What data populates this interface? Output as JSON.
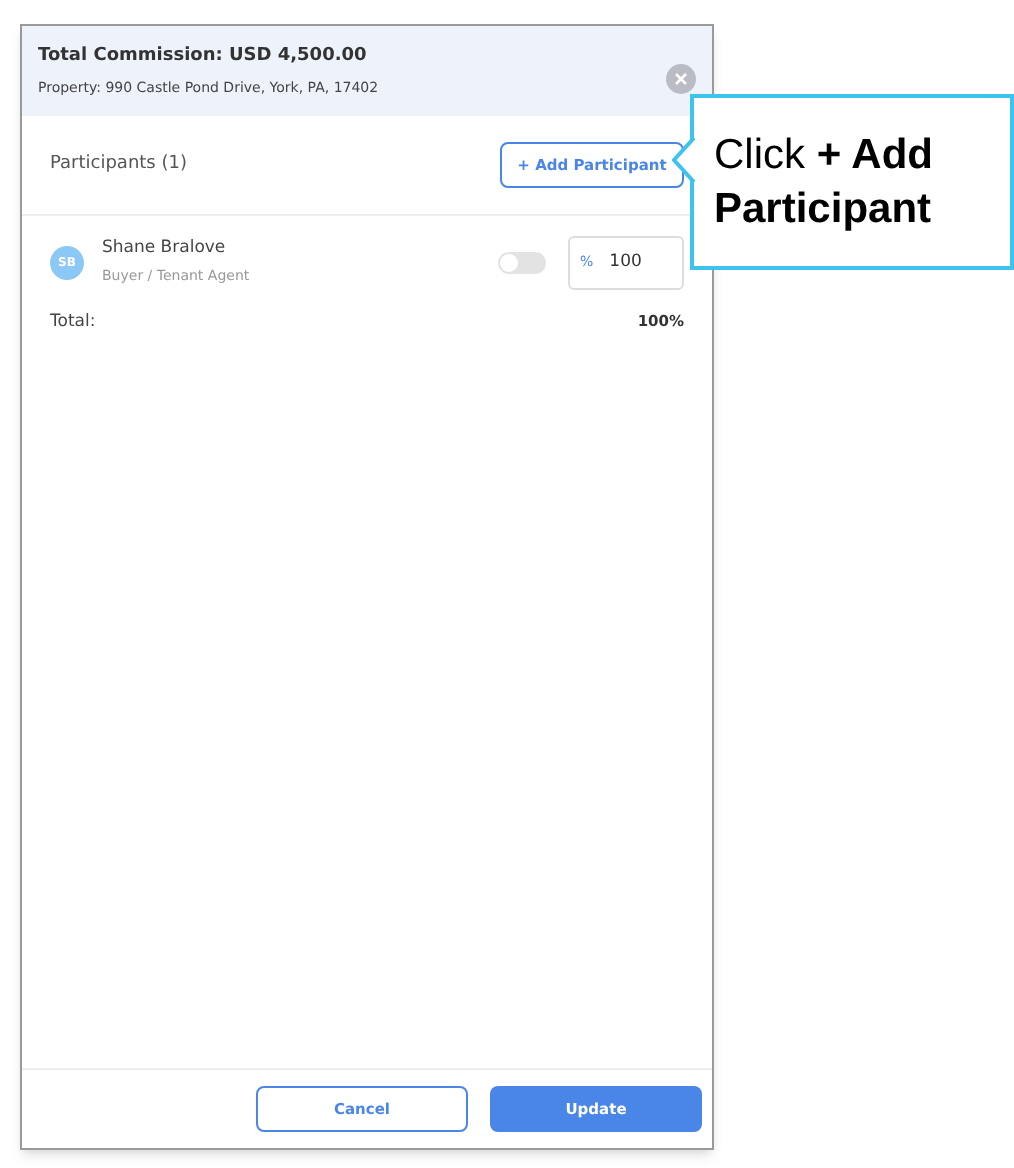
{
  "header": {
    "title": "Total Commission: USD 4,500.00",
    "subtitle": "Property: 990 Castle Pond Drive, York, PA, 17402"
  },
  "participants": {
    "heading": "Participants (1)",
    "add_button": "+ Add Participant",
    "rows": [
      {
        "initials": "SB",
        "name": "Shane Bralove",
        "role": "Buyer / Tenant Agent",
        "toggle_on": false,
        "unit": "%",
        "value": "100"
      }
    ],
    "total_label": "Total:",
    "total_value": "100%"
  },
  "footer": {
    "cancel": "Cancel",
    "update": "Update"
  },
  "callout": {
    "text": "Click **+ Add Participant**"
  }
}
